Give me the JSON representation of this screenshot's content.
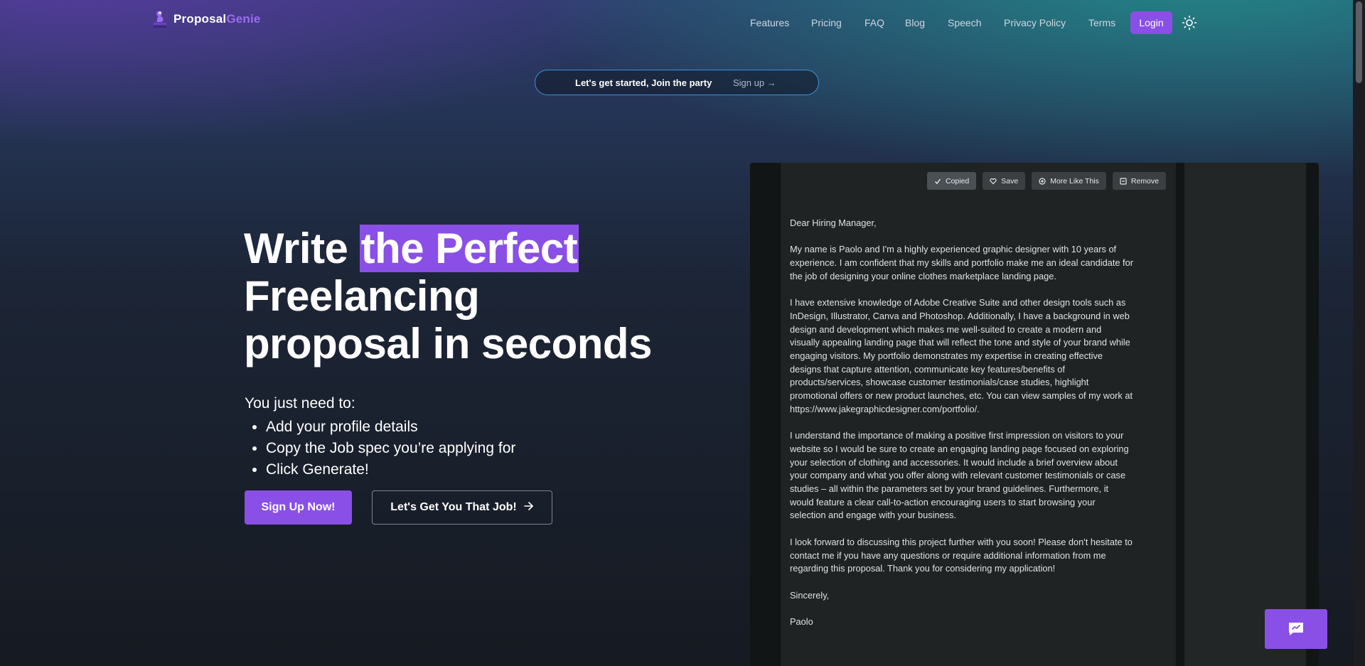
{
  "brand": {
    "name_bold": "Proposal",
    "name_accent": "Genie",
    "icon": "genie-logo-icon"
  },
  "nav": {
    "items": [
      "Features",
      "Pricing",
      "FAQ",
      "Blog",
      "Speech",
      "Privacy Policy",
      "Terms"
    ],
    "login_label": "Login",
    "theme_icon": "sun-icon"
  },
  "banner": {
    "text": "Let's get started, Join the party",
    "link": "Sign up →"
  },
  "hero": {
    "line1_plain": "Write ",
    "line1_highlight": "the Perfect",
    "line2": "Freelancing",
    "line3": "proposal in seconds",
    "intro": "You just need to:",
    "bullets": [
      "Add your profile details",
      "Copy the Job spec you’re applying for",
      "Click Generate!"
    ],
    "cta_primary": "Sign Up Now!",
    "cta_secondary": "Let's Get You That Job!",
    "cta_secondary_icon": "arrow-right-icon"
  },
  "preview": {
    "toolbar": [
      {
        "label": "Copied",
        "icon": "check-icon"
      },
      {
        "label": "Save",
        "icon": "heart-icon"
      },
      {
        "label": "More Like This",
        "icon": "plus-circle-icon"
      },
      {
        "label": "Remove",
        "icon": "minus-square-icon"
      }
    ],
    "letter": [
      "Dear Hiring Manager,",
      "My name is Paolo and I'm a highly experienced graphic designer with 10 years of experience. I am confident that my skills and portfolio make me an ideal candidate for the job of designing your online clothes marketplace landing page.",
      "I have extensive knowledge of Adobe Creative Suite and other design tools such as InDesign, Illustrator, Canva and Photoshop. Additionally, I have a background in web design and development which makes me well-suited to create a modern and visually appealing landing page that will reflect the tone and style of your brand while engaging visitors. My portfolio demonstrates my expertise in creating effective designs that capture attention, communicate key features/benefits of products/services, showcase customer testimonials/case studies, highlight promotional offers or new product launches, etc. You can view samples of my work at https://www.jakegraphicdesigner.com/portfolio/.",
      "I understand the importance of making a positive first impression on visitors to your website so I would be sure to create an engaging landing page focused on exploring your selection of clothing and accessories. It would include a brief overview about your company and what you offer along with relevant customer testimonials or case studies – all within the parameters set by your brand guidelines. Furthermore, it would feature a clear call-to-action encouraging users to start browsing your selection and engage with your business.",
      "I look forward to discussing this project further with you soon! Please don't hesitate to contact me if you have any questions or require additional information from me regarding this proposal. Thank you for considering my application!",
      "Sincerely,",
      "Paolo"
    ]
  },
  "feedback": {
    "icon": "feedback-chat-icon"
  },
  "colors": {
    "accent": "#8a4fe6",
    "pill_border": "#3f8fd6"
  }
}
